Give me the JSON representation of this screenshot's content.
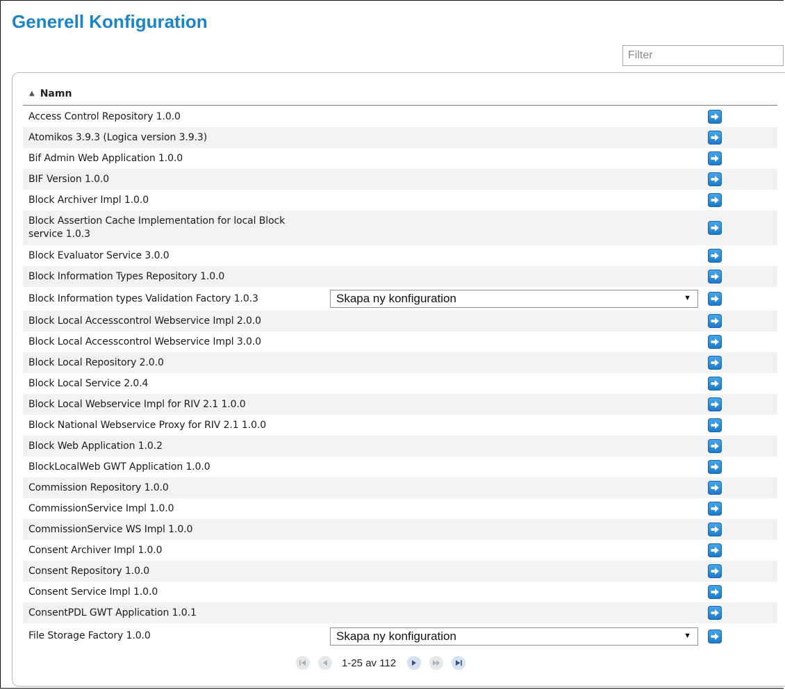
{
  "page": {
    "title": "Generell Konfiguration",
    "filter_placeholder": "Filter",
    "accent": "#1b84c5"
  },
  "table": {
    "header": {
      "label": "Namn",
      "sort": "ascending",
      "sort_icon": "triangle-up-icon"
    },
    "select_label": "Skapa ny konfiguration",
    "action_icon": "arrow-right-icon",
    "rows": [
      {
        "name": "Access Control Repository 1.0.0"
      },
      {
        "name": "Atomikos 3.9.3 (Logica version 3.9.3)"
      },
      {
        "name": "Bif Admin Web Application 1.0.0"
      },
      {
        "name": "BIF Version 1.0.0"
      },
      {
        "name": "Block Archiver Impl 1.0.0"
      },
      {
        "name": "Block Assertion Cache Implementation for local Block service 1.0.3"
      },
      {
        "name": "Block Evaluator Service 3.0.0"
      },
      {
        "name": "Block Information Types Repository 1.0.0"
      },
      {
        "name": "Block Information types Validation Factory 1.0.3",
        "has_select": true
      },
      {
        "name": "Block Local Accesscontrol Webservice Impl 2.0.0"
      },
      {
        "name": "Block Local Accesscontrol Webservice Impl 3.0.0"
      },
      {
        "name": "Block Local Repository 2.0.0"
      },
      {
        "name": "Block Local Service 2.0.4"
      },
      {
        "name": "Block Local Webservice Impl for RIV 2.1 1.0.0"
      },
      {
        "name": "Block National Webservice Proxy for RIV 2.1 1.0.0"
      },
      {
        "name": "Block Web Application 1.0.2"
      },
      {
        "name": "BlockLocalWeb GWT Application 1.0.0"
      },
      {
        "name": "Commission Repository 1.0.0"
      },
      {
        "name": "CommissionService Impl 1.0.0"
      },
      {
        "name": "CommissionService WS Impl 1.0.0"
      },
      {
        "name": "Consent Archiver Impl 1.0.0"
      },
      {
        "name": "Consent Repository 1.0.0"
      },
      {
        "name": "Consent Service Impl 1.0.0"
      },
      {
        "name": "ConsentPDL GWT Application 1.0.1"
      },
      {
        "name": "File Storage Factory 1.0.0",
        "has_select": true
      }
    ]
  },
  "pager": {
    "text": "1-25 av 112",
    "first_icon": "first-page-icon",
    "prev_icon": "previous-page-icon",
    "next_icon": "next-page-icon",
    "fast_forward_icon": "fast-forward-icon",
    "last_icon": "last-page-icon"
  }
}
